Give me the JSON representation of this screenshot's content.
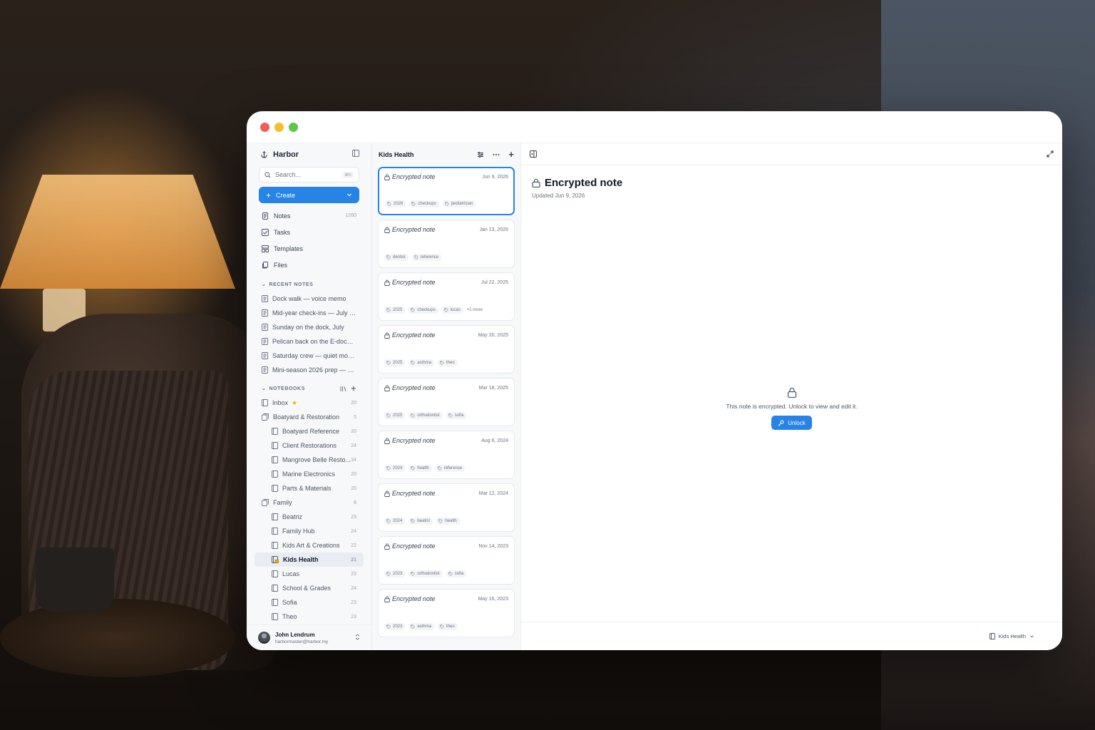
{
  "app": {
    "name": "Harbor"
  },
  "search": {
    "placeholder": "Search...",
    "shortcut": "⌘K"
  },
  "create": {
    "label": "Create"
  },
  "nav": [
    {
      "label": "Notes",
      "count": "1260",
      "icon": "note-icon"
    },
    {
      "label": "Tasks",
      "count": "",
      "icon": "task-icon"
    },
    {
      "label": "Templates",
      "count": "",
      "icon": "template-icon"
    },
    {
      "label": "Files",
      "count": "",
      "icon": "files-icon"
    }
  ],
  "recent": {
    "heading": "RECENT NOTES",
    "items": [
      "Dock walk — voice memo",
      "Mid-year check-ins — July 2...",
      "Sunday on the dock, July",
      "Pelican back on the E-dock li...",
      "Saturday crew — quiet morni...",
      "Mini-season 2026 prep — ge..."
    ]
  },
  "notebooks": {
    "heading": "NOTEBOOKS",
    "items": [
      {
        "label": "Inbox",
        "count": "20",
        "level": 0,
        "star": true
      },
      {
        "label": "Boatyard & Restoration",
        "count": "5",
        "level": 0,
        "stack": true
      },
      {
        "label": "Boatyard Reference",
        "count": "20",
        "level": 1
      },
      {
        "label": "Client Restorations",
        "count": "24",
        "level": 1
      },
      {
        "label": "Mangrove Belle Resto...",
        "count": "34",
        "level": 1
      },
      {
        "label": "Marine Electronics",
        "count": "20",
        "level": 1
      },
      {
        "label": "Parts & Materials",
        "count": "20",
        "level": 1
      },
      {
        "label": "Family",
        "count": "8",
        "level": 0,
        "stack": true
      },
      {
        "label": "Beatriz",
        "count": "23",
        "level": 1
      },
      {
        "label": "Family Hub",
        "count": "24",
        "level": 1
      },
      {
        "label": "Kids Art & Creations",
        "count": "22",
        "level": 1
      },
      {
        "label": "Kids Health",
        "count": "21",
        "level": 1,
        "active": true,
        "locked": true
      },
      {
        "label": "Lucas",
        "count": "23",
        "level": 1
      },
      {
        "label": "School & Grades",
        "count": "24",
        "level": 1
      },
      {
        "label": "Sofia",
        "count": "23",
        "level": 1
      },
      {
        "label": "Theo",
        "count": "23",
        "level": 1
      }
    ]
  },
  "user": {
    "name": "John Lendrum",
    "email": "harbormaster@harbor.my"
  },
  "list": {
    "title": "Kids Health",
    "notes": [
      {
        "title": "Encrypted note",
        "date": "Jun 9, 2026",
        "tags": [
          "2026",
          "checkups",
          "pediatrician"
        ],
        "more": "",
        "selected": true
      },
      {
        "title": "Encrypted note",
        "date": "Jan 13, 2026",
        "tags": [
          "dentist",
          "reference"
        ],
        "more": ""
      },
      {
        "title": "Encrypted note",
        "date": "Jul 22, 2025",
        "tags": [
          "2025",
          "checkups",
          "lucas"
        ],
        "more": "+1 more"
      },
      {
        "title": "Encrypted note",
        "date": "May 20, 2025",
        "tags": [
          "2025",
          "asthma",
          "theo"
        ],
        "more": ""
      },
      {
        "title": "Encrypted note",
        "date": "Mar 18, 2025",
        "tags": [
          "2025",
          "orthodontist",
          "sofia"
        ],
        "more": ""
      },
      {
        "title": "Encrypted note",
        "date": "Aug 6, 2024",
        "tags": [
          "2024",
          "health",
          "reference"
        ],
        "more": ""
      },
      {
        "title": "Encrypted note",
        "date": "Mar 12, 2024",
        "tags": [
          "2024",
          "beatriz",
          "health"
        ],
        "more": ""
      },
      {
        "title": "Encrypted note",
        "date": "Nov 14, 2023",
        "tags": [
          "2023",
          "orthodontist",
          "sofia"
        ],
        "more": ""
      },
      {
        "title": "Encrypted note",
        "date": "May 16, 2023",
        "tags": [
          "2023",
          "asthma",
          "theo"
        ],
        "more": ""
      }
    ]
  },
  "detail": {
    "title": "Encrypted note",
    "updated": "Updated Jun 9, 2026",
    "locked_message": "This note is encrypted. Unlock to view and edit it.",
    "unlock_label": "Unlock",
    "footer_notebook": "Kids Health"
  },
  "colors": {
    "accent": "#2784e6",
    "star": "#f5b301"
  }
}
